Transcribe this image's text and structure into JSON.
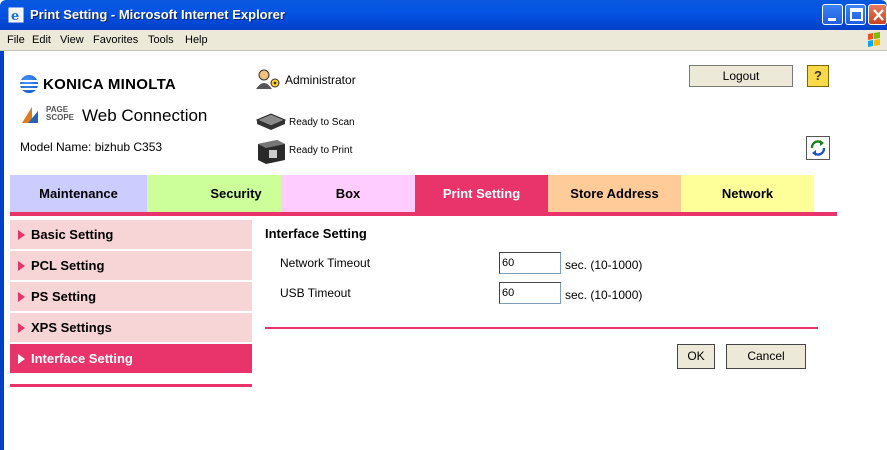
{
  "window": {
    "title": "Print Setting - Microsoft Internet Explorer"
  },
  "menu": [
    {
      "u": "F",
      "rest": "ile"
    },
    {
      "u": "E",
      "rest": "dit"
    },
    {
      "u": "V",
      "rest": "iew"
    },
    {
      "u": "",
      "pre": "F",
      "u2": "a",
      "rest": "vorites"
    },
    {
      "u": "T",
      "rest": "ools"
    },
    {
      "u": "H",
      "rest": "elp"
    }
  ],
  "menu_labels": {
    "file": "File",
    "edit": "Edit",
    "view": "View",
    "favorites": "Favorites",
    "tools": "Tools",
    "help": "Help"
  },
  "header": {
    "brand": "KONICA MINOLTA",
    "product_tag_top": "PAGE",
    "product_tag_bottom": "SCOPE",
    "product": "Web Connection",
    "model": "Model Name: bizhub C353",
    "user": "Administrator",
    "scan_status": "Ready to Scan",
    "print_status": "Ready to Print",
    "logout_label": "Logout",
    "help_label": "?"
  },
  "tabs": [
    {
      "label": "Maintenance",
      "color": "#ccccff"
    },
    {
      "label": "Security",
      "color": "#ccff99"
    },
    {
      "label": "Box",
      "color": "#ffccff"
    },
    {
      "label": "Print Setting",
      "color": "#e8336b",
      "active": true
    },
    {
      "label": "Store Address",
      "color": "#ffcc99"
    },
    {
      "label": "Network",
      "color": "#ffff99"
    }
  ],
  "sidebar": {
    "items": [
      {
        "label": "Basic Setting"
      },
      {
        "label": "PCL Setting"
      },
      {
        "label": "PS Setting"
      },
      {
        "label": "XPS Settings"
      },
      {
        "label": "Interface Setting",
        "active": true
      }
    ]
  },
  "main": {
    "title": "Interface Setting",
    "fields": [
      {
        "label": "Network Timeout",
        "value": "60",
        "unit": "sec. (10-1000)"
      },
      {
        "label": "USB Timeout",
        "value": "60",
        "unit": "sec. (10-1000)"
      }
    ],
    "ok_label": "OK",
    "cancel_label": "Cancel"
  },
  "icons": {
    "ie": "internet-explorer-icon",
    "admin": "administrator-icon",
    "scanner": "scanner-icon",
    "printer": "printer-icon",
    "refresh": "refresh-icon",
    "windows": "windows-logo-icon"
  },
  "colors": {
    "accent": "#e8336b",
    "sidebar_bg": "#f7d4d6",
    "titlebar": "#0454e4"
  }
}
